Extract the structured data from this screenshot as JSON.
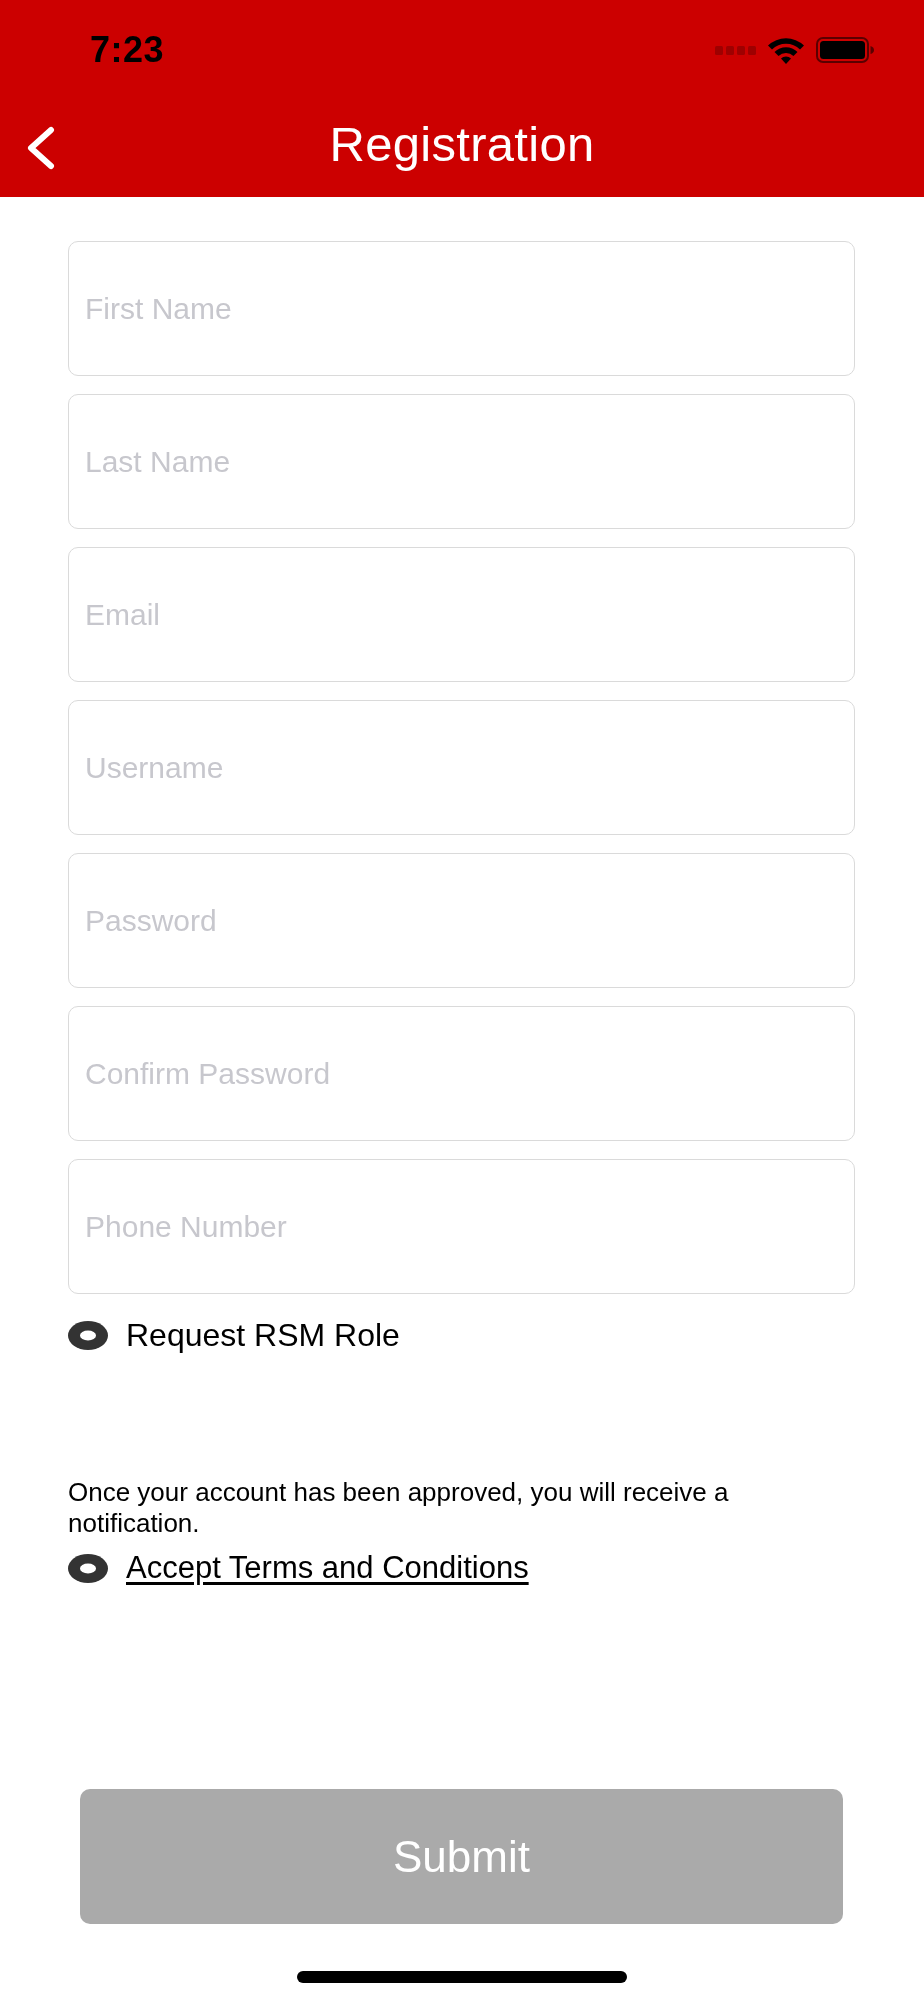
{
  "status_bar": {
    "time": "7:23"
  },
  "nav_bar": {
    "title": "Registration"
  },
  "fields": [
    {
      "placeholder": "First Name"
    },
    {
      "placeholder": "Last Name"
    },
    {
      "placeholder": "Email"
    },
    {
      "placeholder": "Username"
    },
    {
      "placeholder": "Password"
    },
    {
      "placeholder": "Confirm Password"
    },
    {
      "placeholder": "Phone Number"
    }
  ],
  "role_option": {
    "label": "Request RSM Role",
    "checked": false
  },
  "note": "Once your account has been approved, you will receive a notification.",
  "terms_option": {
    "label": "Accept Terms and Conditions",
    "checked": false
  },
  "submit_button": {
    "label": "Submit",
    "disabled": true
  }
}
